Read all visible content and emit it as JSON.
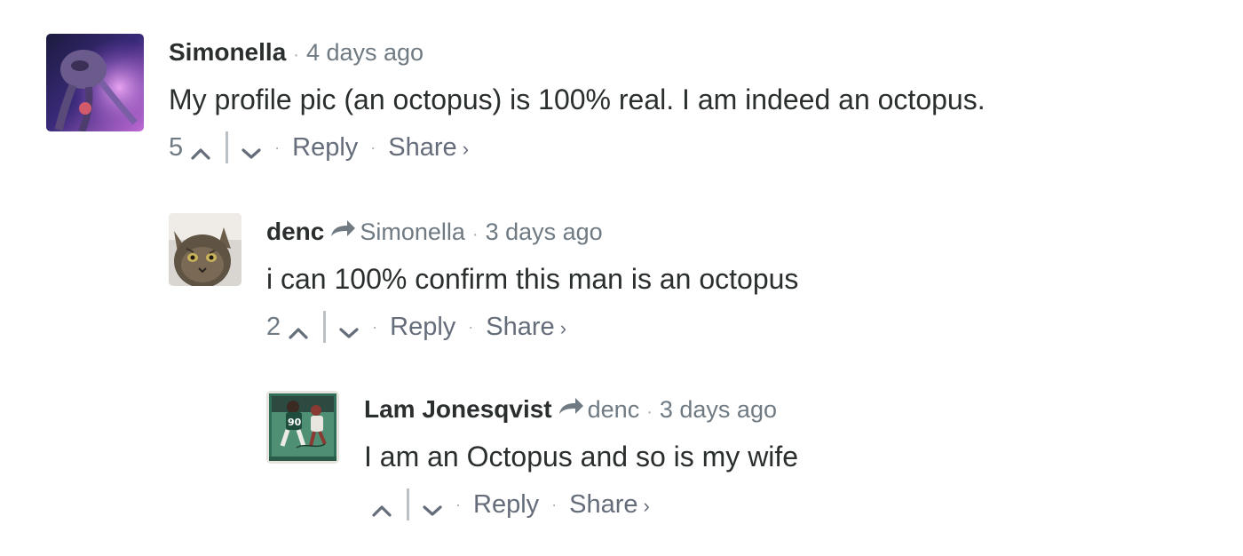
{
  "comments": [
    {
      "author": "Simonella",
      "parent": "",
      "time": "4 days ago",
      "text": "My profile pic (an octopus) is 100% real. I am indeed an octopus.",
      "votes": "5",
      "reply_label": "Reply",
      "share_label": "Share",
      "share_chevron": "›",
      "avatar_icon": "octopus-avatar"
    },
    {
      "author": "denc",
      "parent": "Simonella",
      "time": "3 days ago",
      "text": "i can 100% confirm this man is an octopus",
      "votes": "2",
      "reply_label": "Reply",
      "share_label": "Share",
      "share_chevron": "›",
      "avatar_icon": "cat-avatar"
    },
    {
      "author": "Lam Jonesqvist",
      "parent": "denc",
      "time": "3 days ago",
      "text": "I am an Octopus and so is my wife",
      "votes": "",
      "reply_label": "Reply",
      "share_label": "Share",
      "share_chevron": "›",
      "avatar_icon": "football-card-avatar"
    }
  ],
  "separator_dot": "·",
  "colors": {
    "author": "#2a2e2e",
    "meta": "#6f7a82",
    "text": "#2a2e2e",
    "link": "#656c7a"
  }
}
